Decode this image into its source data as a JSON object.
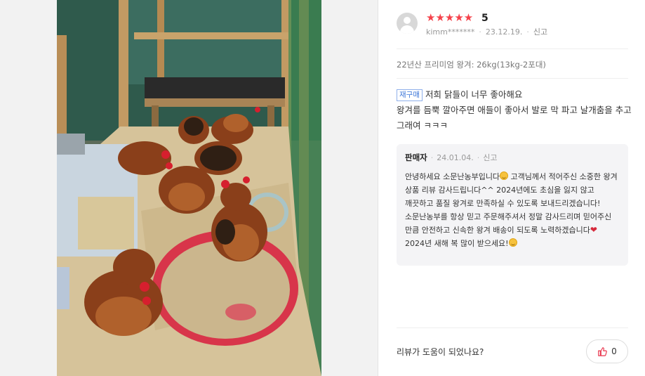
{
  "photo": {
    "alt_subject": "chickens-in-coop-photo"
  },
  "review": {
    "stars": "★★★★★",
    "rating": "5",
    "user": "kimm*******",
    "date": "23.12.19.",
    "report": "신고",
    "option": "22년산 프리미엄 왕겨: 26kg(13kg-2포대)",
    "badge": "재구매",
    "text_line1": "저희 닭들이 너무 좋아해요",
    "text_line2": "왕겨를 듬뿍 깔아주면 애들이 좋아서 발로 막 파고 날개춤을 추고 그래여 ㅋㅋㅋ"
  },
  "reply": {
    "seller": "판매자",
    "date": "24.01.04.",
    "report": "신고",
    "part1": "안녕하세요 소문난농부입니다",
    "part2": " 고객님께서 적어주신 소중한 왕겨 상품 리뷰 감사드립니다^^ 2024년에도 초심을 잃지 않고 깨끗하고 품질 왕겨로 만족하실 수 있도록 보내드리겠습니다! 소문난농부를 항상 믿고 주문해주셔서 정말 감사드리며 믿어주신 만큼 안전하고 신속한 왕겨 배송이 되도록 노력하겠습니다",
    "part3": " 2024년 새해 복 많이 받으세요!"
  },
  "footer": {
    "helpful_question": "리뷰가 도움이 되었나요?",
    "like_count": "0"
  },
  "colors": {
    "star": "#f5424b",
    "badge": "#3f78d9",
    "reply_bg": "#f4f4f6"
  }
}
